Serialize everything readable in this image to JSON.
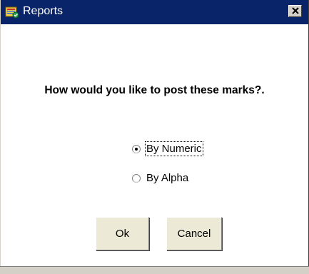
{
  "window": {
    "title": "Reports",
    "icon": "reports-app-icon",
    "close_icon": "close-icon"
  },
  "dialog": {
    "question": "How would you like to post these marks?.",
    "options": [
      {
        "label": "By Numeric",
        "selected": true
      },
      {
        "label": "By Alpha",
        "selected": false
      }
    ],
    "buttons": {
      "ok_label": "Ok",
      "cancel_label": "Cancel"
    }
  },
  "colors": {
    "titlebar": "#0a246a",
    "title_text": "#ffffff",
    "background": "#ffffff",
    "button_face": "#ecead7"
  }
}
